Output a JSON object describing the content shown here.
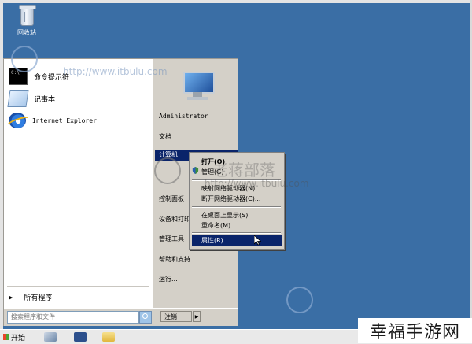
{
  "desktop": {
    "recycle_bin_label": "回收站"
  },
  "start_menu": {
    "pinned": [
      {
        "label": "命令提示符",
        "icon": "cmd-icon"
      },
      {
        "label": "记事本",
        "icon": "notepad-icon"
      },
      {
        "label": "Internet Explorer",
        "icon": "ie-icon"
      }
    ],
    "all_programs": "所有程序",
    "search_placeholder": "搜索程序和文件",
    "logoff": "注销",
    "logoff_arrow": "▶",
    "right": {
      "user": "Administrator",
      "documents": "文档",
      "computer": "计算机",
      "control_panel": "控制面板",
      "devices": "设备和打印",
      "admin_tools": "管理工具",
      "help": "帮助和支持",
      "run": "运行..."
    }
  },
  "context_menu": {
    "open": "打开(O)",
    "manage": "管理(G)",
    "map_drive": "映射网络驱动器(N)...",
    "disconnect_drive": "断开网络驱动器(C)...",
    "show_on_desktop": "在桌面上显示(S)",
    "rename": "重命名(M)",
    "properties": "属性(R)"
  },
  "taskbar": {
    "start": "开始"
  },
  "watermark": {
    "url": "http://www.itbulu.com",
    "text": "老蒋部落"
  },
  "site_badge": "幸福手游网",
  "colors": {
    "desktop": "#3a6ea5",
    "highlight": "#0a246a",
    "menu_face": "#d4d0c8"
  }
}
